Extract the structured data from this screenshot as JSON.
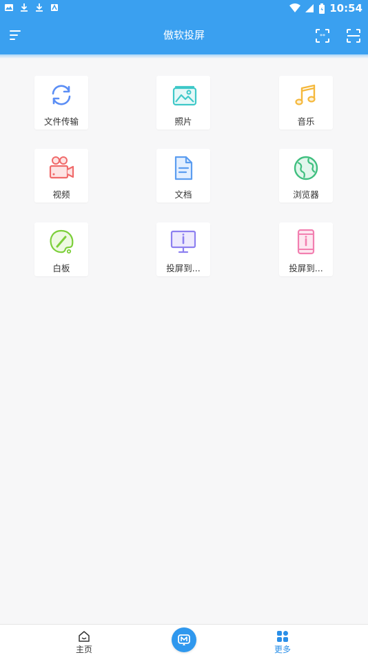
{
  "status": {
    "time": "10:54",
    "icons": [
      "image-notification-icon",
      "download-icon",
      "download-icon",
      "android-notification-icon",
      "wifi-icon",
      "cell-signal-icon",
      "battery-icon"
    ]
  },
  "app_bar": {
    "title": "傲软投屏",
    "left_icon": "menu-icon",
    "right_icons": [
      "scan-code-icon",
      "scan-frame-icon"
    ],
    "color": "#3aa0f0"
  },
  "tiles": [
    {
      "label": "文件传输",
      "icon": "file-transfer-icon",
      "color": "#5b8ef5"
    },
    {
      "label": "照片",
      "icon": "photo-icon",
      "color": "#3ec8c8"
    },
    {
      "label": "音乐",
      "icon": "music-icon",
      "color": "#f5b83b"
    },
    {
      "label": "视频",
      "icon": "video-camera-icon",
      "color": "#f06a6a"
    },
    {
      "label": "文档",
      "icon": "document-icon",
      "color": "#5b9df0"
    },
    {
      "label": "浏览器",
      "icon": "globe-icon",
      "color": "#3fbf7f"
    },
    {
      "label": "白板",
      "icon": "whiteboard-palette-icon",
      "color": "#7ccf3a"
    },
    {
      "label": "投屏到...",
      "icon": "monitor-icon",
      "color": "#8c7ff0"
    },
    {
      "label": "投屏到...",
      "icon": "phone-icon",
      "color": "#f27fb0"
    }
  ],
  "bottom_nav": {
    "home_label": "主页",
    "more_label": "更多",
    "center_icon": "cast-logo-icon",
    "active_color": "#2a8fe8"
  }
}
